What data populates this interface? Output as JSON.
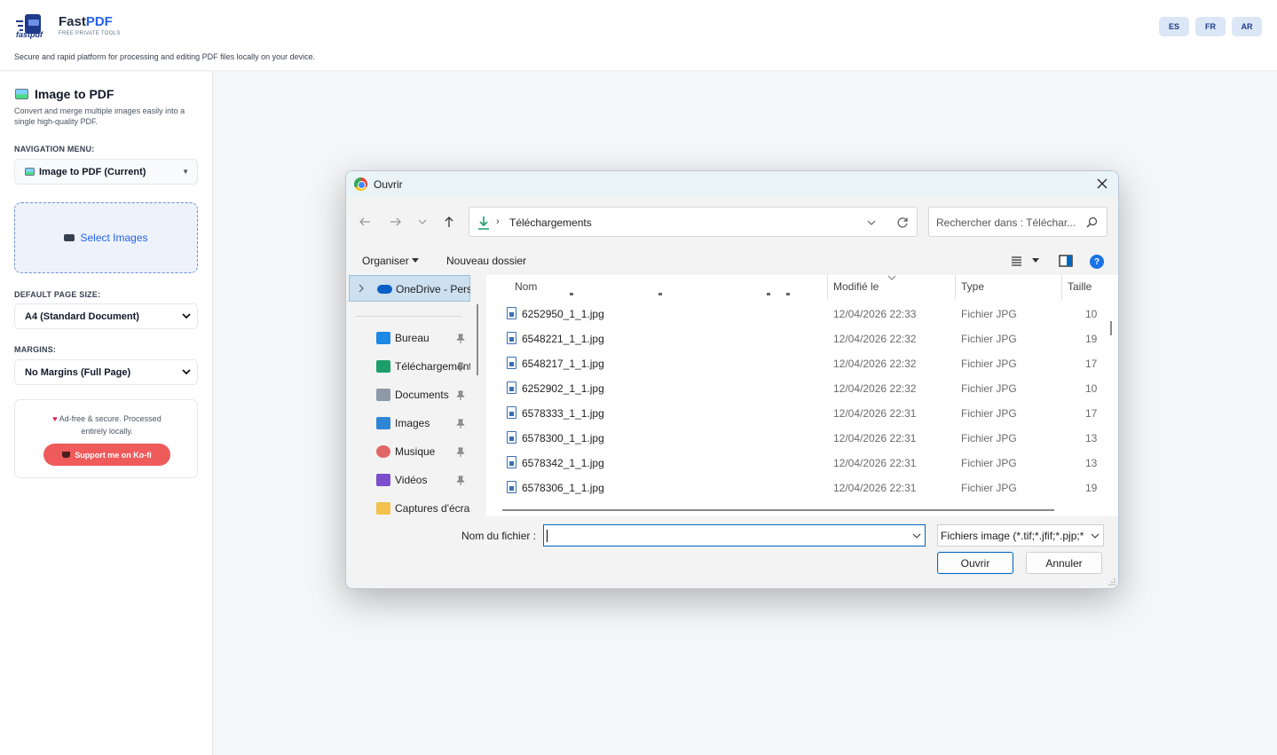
{
  "header": {
    "logo_word": "fastpdf",
    "brand_prefix": "Fast",
    "brand_suffix": "PDF",
    "brand_tag": "FREE PRIVATE TOOLS",
    "tagline": "Secure and rapid platform for processing and editing PDF files locally on your device.",
    "languages": [
      "ES",
      "FR",
      "AR"
    ]
  },
  "sidebar": {
    "tool_title": "Image to PDF",
    "tool_desc": "Convert and merge multiple images easily into a single high-quality PDF.",
    "nav_label": "NAVIGATION MENU:",
    "nav_value": "Image to PDF (Current)",
    "dropzone_label": "Select Images",
    "page_size_label": "DEFAULT PAGE SIZE:",
    "page_size_value": "A4 (Standard Document)",
    "margins_label": "MARGINS:",
    "margins_value": "No Margins (Full Page)",
    "support_line1": "Ad-free & secure. Processed",
    "support_line2": "entirely locally.",
    "kofi_label": "Support me on Ko-fi"
  },
  "dialog": {
    "title": "Ouvrir",
    "path_folder": "Téléchargements",
    "search_placeholder": "Rechercher dans : Téléchar...",
    "organize_label": "Organiser",
    "new_folder_label": "Nouveau dossier",
    "help_glyph": "?",
    "nav_onedrive": "OneDrive - Perso",
    "nav_items": [
      {
        "label": "Bureau",
        "color": "#1e88e5"
      },
      {
        "label": "Téléchargements",
        "color": "#1e9e6a"
      },
      {
        "label": "Documents",
        "color": "#8d99a6"
      },
      {
        "label": "Images",
        "color": "#2f86d6"
      },
      {
        "label": "Musique",
        "color": "#e06666"
      },
      {
        "label": "Vidéos",
        "color": "#7c4dcc"
      },
      {
        "label": "Captures d'écran",
        "color": "#f2c14e"
      }
    ],
    "columns": {
      "name": "Nom",
      "modified": "Modifié le",
      "type": "Type",
      "size": "Taille"
    },
    "files": [
      {
        "name": "6252950_1_1.jpg",
        "modified": "12/04/2026 22:33",
        "type": "Fichier JPG",
        "size": "10"
      },
      {
        "name": "6548221_1_1.jpg",
        "modified": "12/04/2026 22:32",
        "type": "Fichier JPG",
        "size": "19"
      },
      {
        "name": "6548217_1_1.jpg",
        "modified": "12/04/2026 22:32",
        "type": "Fichier JPG",
        "size": "17"
      },
      {
        "name": "6252902_1_1.jpg",
        "modified": "12/04/2026 22:32",
        "type": "Fichier JPG",
        "size": "10"
      },
      {
        "name": "6578333_1_1.jpg",
        "modified": "12/04/2026 22:31",
        "type": "Fichier JPG",
        "size": "17"
      },
      {
        "name": "6578300_1_1.jpg",
        "modified": "12/04/2026 22:31",
        "type": "Fichier JPG",
        "size": "13"
      },
      {
        "name": "6578342_1_1.jpg",
        "modified": "12/04/2026 22:31",
        "type": "Fichier JPG",
        "size": "13"
      },
      {
        "name": "6578306_1_1.jpg",
        "modified": "12/04/2026 22:31",
        "type": "Fichier JPG",
        "size": "19"
      }
    ],
    "filename_label": "Nom du fichier :",
    "filename_value": "",
    "filetype_value": "Fichiers image (*.tif;*.jfif;*.pjp;*",
    "open_label": "Ouvrir",
    "cancel_label": "Annuler"
  }
}
